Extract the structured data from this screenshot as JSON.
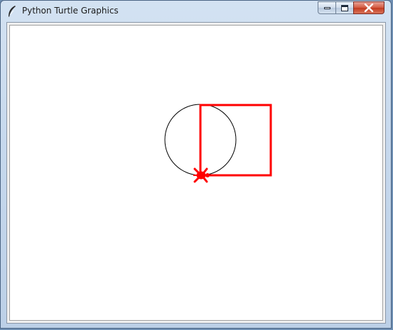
{
  "window": {
    "title": "Python Turtle Graphics",
    "icon": "feather-icon",
    "controls": [
      "minimize-icon",
      "maximize-icon",
      "close-icon"
    ]
  },
  "drawing": {
    "pen_color": "#ff0000",
    "circle_color": "#000000",
    "background": "#ffffff",
    "turtle_shape": "turtle-icon"
  },
  "colors": {
    "titlebar": "#c6d8ed",
    "close_button": "#c23a1f"
  }
}
